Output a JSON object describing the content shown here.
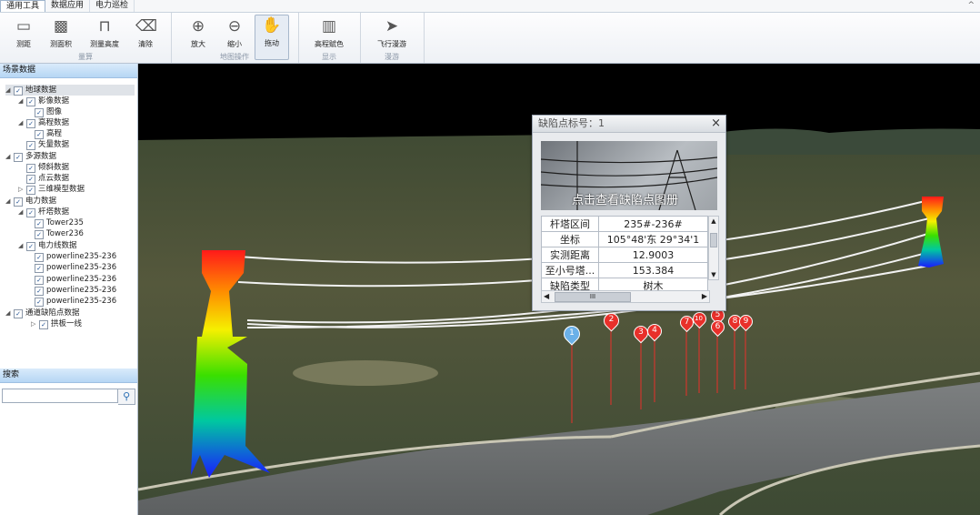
{
  "menu": {
    "tabs": [
      "通用工具",
      "数据应用",
      "电力巡检"
    ],
    "collapse_glyph": "^"
  },
  "ribbon": {
    "groups": [
      {
        "label": "量算",
        "buttons": [
          "测距",
          "测面积",
          "测量高度",
          "清除"
        ]
      },
      {
        "label": "地图操作",
        "buttons": [
          "放大",
          "缩小",
          "拖动"
        ]
      },
      {
        "label": "显示",
        "buttons": [
          "高程赋色"
        ]
      },
      {
        "label": "漫游",
        "buttons": [
          "飞行漫游"
        ]
      }
    ]
  },
  "scene_panel": {
    "title": "场景数据",
    "tree": [
      "地球数据",
      "影像数据",
      "图像",
      "高程数据",
      "高程",
      "矢量数据",
      "多源数据",
      "倾斜数据",
      "点云数据",
      "三维模型数据",
      "电力数据",
      "杆塔数据",
      "Tower235",
      "Tower236",
      "电力线数据",
      "powerline235-236",
      "powerline235-236",
      "powerline235-236",
      "powerline235-236",
      "powerline235-236",
      "通道缺陷点数据",
      "拱板一线"
    ]
  },
  "search_panel": {
    "title": "搜索",
    "placeholder": "",
    "value": ""
  },
  "defect_popup": {
    "title": "缺陷点标号：1",
    "close": "×",
    "image_caption": "点击查看缺陷点图册",
    "rows": [
      {
        "key": "杆塔区间",
        "value": "235#-236#"
      },
      {
        "key": "坐标",
        "value": "105°48'东  29°34'1"
      },
      {
        "key": "实测距离",
        "value": "12.9003"
      },
      {
        "key": "至小号塔...",
        "value": "153.384"
      },
      {
        "key": "缺陷类型",
        "value": "树木"
      }
    ],
    "hscroll_thumb": "III"
  },
  "markers": [
    "1",
    "2",
    "3",
    "4",
    "7",
    "10",
    "5",
    "6",
    "8",
    "9"
  ],
  "colors": {
    "marker_red": "#e8302a",
    "marker_blue": "#6ab0e8",
    "panel_header": "#c6e0f8"
  }
}
